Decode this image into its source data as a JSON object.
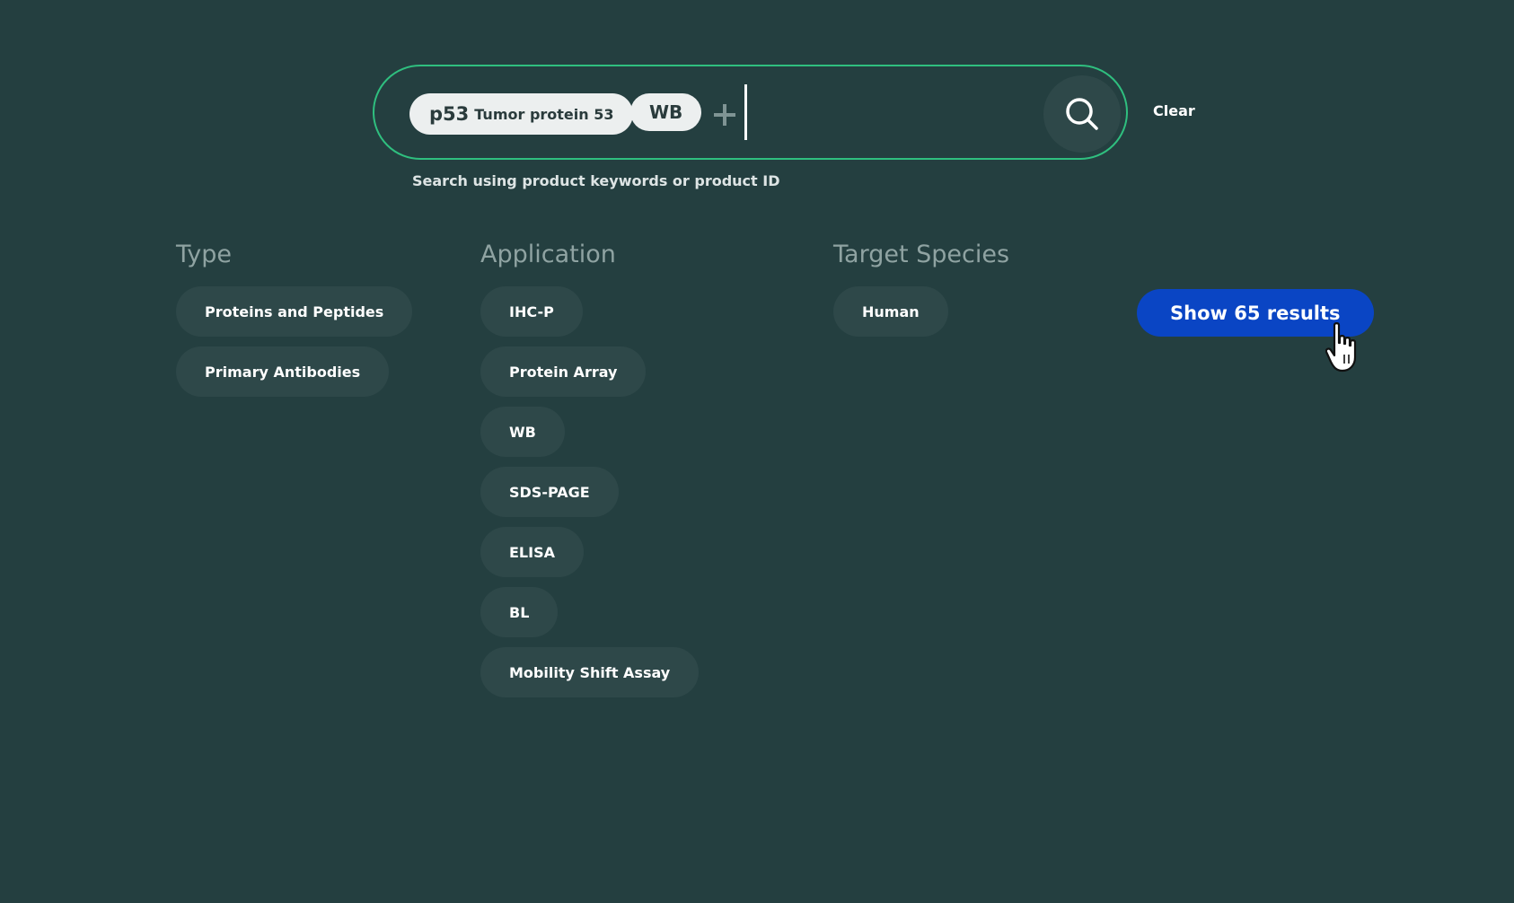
{
  "search": {
    "chips": [
      {
        "code": "p53",
        "description": "Tumor protein 53"
      },
      {
        "code": "WB"
      }
    ],
    "input_value": "",
    "helper_text": "Search using product keywords or product ID",
    "clear_label": "Clear",
    "border_color": "#2fbf7f"
  },
  "facets": {
    "type": {
      "heading": "Type",
      "items": [
        "Proteins and Peptides",
        "Primary Antibodies"
      ]
    },
    "application": {
      "heading": "Application",
      "items": [
        "IHC-P",
        "Protein Array",
        "WB",
        "SDS-PAGE",
        "ELISA",
        "BL",
        "Mobility Shift Assay"
      ]
    },
    "species": {
      "heading": "Target Species",
      "items": [
        "Human"
      ]
    }
  },
  "results_button": {
    "label": "Show 65 results",
    "color": "#0a45c4"
  },
  "icons": {
    "search": "search-icon",
    "plus": "plus-icon",
    "cursor": "hand-pointer-icon"
  },
  "colors": {
    "background": "#243f40",
    "pill": "#2e4849",
    "chip": "#ecefef"
  }
}
